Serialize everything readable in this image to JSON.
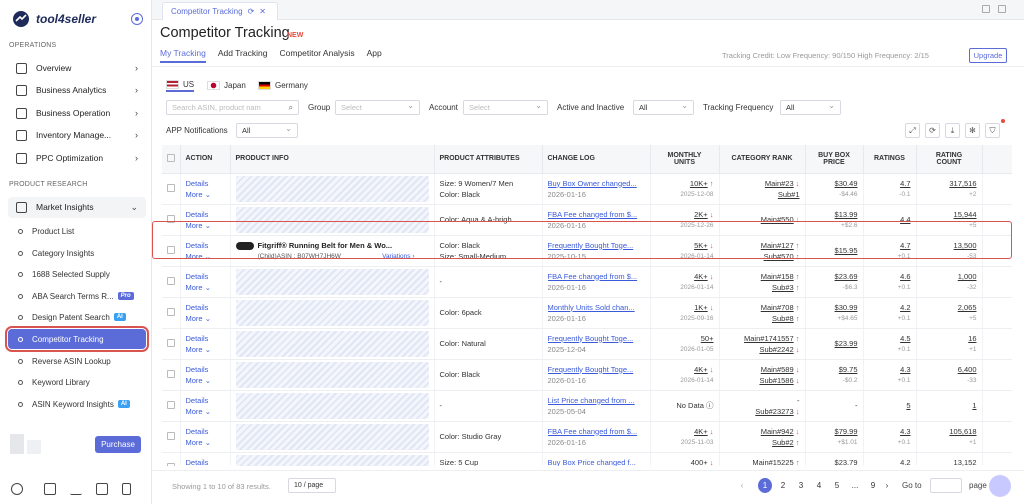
{
  "app": {
    "name": "tool4seller"
  },
  "sidebar": {
    "section_operations": "OPERATIONS",
    "operations": [
      {
        "label": "Overview",
        "icon": "home-icon"
      },
      {
        "label": "Business Analytics",
        "icon": "chart-icon"
      },
      {
        "label": "Business Operation",
        "icon": "briefcase-icon"
      },
      {
        "label": "Inventory Manage...",
        "icon": "box-icon"
      },
      {
        "label": "PPC Optimization",
        "icon": "monitor-icon"
      }
    ],
    "section_research": "PRODUCT RESEARCH",
    "market_insights": "Market Insights",
    "research_items": [
      {
        "label": "Product List",
        "badge": ""
      },
      {
        "label": "Category Insights",
        "badge": ""
      },
      {
        "label": "1688 Selected Supply",
        "badge": ""
      },
      {
        "label": "ABA Search Terms R...",
        "badge": "Pro"
      },
      {
        "label": "Design Patent Search",
        "badge": "AI"
      },
      {
        "label": "Competitor Tracking",
        "badge": ""
      },
      {
        "label": "Reverse ASIN Lookup",
        "badge": ""
      },
      {
        "label": "Keyword Library",
        "badge": ""
      },
      {
        "label": "ASIN Keyword Insights",
        "badge": "AI"
      }
    ],
    "purchase": "Purchase"
  },
  "topbar": {
    "tab_label": "Competitor Tracking"
  },
  "page": {
    "title": "Competitor Tracking",
    "title_badge": "NEW",
    "tabs": [
      "My Tracking",
      "Add Tracking",
      "Competitor Analysis",
      "App"
    ],
    "credit": "Tracking Credit: Low Frequency: 90/150 High Frequency: 2/15",
    "upgrade": "Upgrade"
  },
  "markets": [
    "US",
    "Japan",
    "Germany"
  ],
  "filters": {
    "search_placeholder": "Search ASIN, product nam",
    "group_label": "Group",
    "group_placeholder": "Select",
    "account_label": "Account",
    "account_placeholder": "Select",
    "active_label": "Active and Inactive",
    "active_value": "All",
    "frequency_label": "Tracking Frequency",
    "frequency_value": "All",
    "app_label": "APP Notifications",
    "app_value": "All"
  },
  "table": {
    "headers": {
      "action": "ACTION",
      "product_info": "PRODUCT INFO",
      "attributes": "PRODUCT ATTRIBUTES",
      "change_log": "CHANGE LOG",
      "monthly_units_1": "MONTHLY",
      "monthly_units_2": "UNITS",
      "category_rank": "CATEGORY RANK",
      "buy_box_1": "BUY BOX",
      "buy_box_2": "PRICE",
      "ratings": "RATINGS",
      "rating_count_1": "RATING",
      "rating_count_2": "COUNT"
    },
    "details": "Details",
    "more": "More",
    "rows": [
      {
        "attr1": "Size: 9 Women/7 Men",
        "attr2": "Color: Black",
        "log": "Buy Box Owner changed...",
        "log_date": "2026-01-16",
        "units": "10K+",
        "units_dir": "up",
        "units_date": "2025-12-08",
        "main": "Main#23",
        "main_dir": "down",
        "sub": "Sub#1",
        "sub_dir": "",
        "price": "$30.49",
        "price_delta": "-$4.46",
        "rating": "4.7",
        "rating_delta": "-0.1",
        "count": "317,516",
        "count_delta": "+2"
      },
      {
        "attr1": "Color: Aqua & A-brigh...",
        "attr2": "",
        "log": "FBA Fee changed from $...",
        "log_date": "2026-01-16",
        "units": "2K+",
        "units_dir": "down",
        "units_date": "2025-12-26",
        "main": "Main#550",
        "main_dir": "down",
        "sub": "",
        "sub_dir": "",
        "price": "$13.99",
        "price_delta": "+$2.6",
        "rating": "4.4",
        "rating_delta": "",
        "count": "15,944",
        "count_delta": "+5"
      },
      {
        "attr1": "Color: Black",
        "attr2": "Size: Small-Medium",
        "log": "Frequently Bought Toge...",
        "log_date": "2025-10-15",
        "units": "5K+",
        "units_dir": "down",
        "units_date": "2026-01-14",
        "main": "Main#127",
        "main_dir": "up",
        "sub": "Sub#570",
        "sub_dir": "up",
        "price": "$15.95",
        "price_delta": "",
        "rating": "4.7",
        "rating_delta": "+0.1",
        "count": "13,500",
        "count_delta": "-53",
        "product_title": "Fitgriff® Running Belt for Men & Wo...",
        "asin": "(Child)ASIN : B07WH7JH6W",
        "variations": "Variations"
      },
      {
        "attr1": "-",
        "attr2": "",
        "log": "FBA Fee changed from $...",
        "log_date": "2026-01-16",
        "units": "4K+",
        "units_dir": "down",
        "units_date": "2026-01-14",
        "main": "Main#158",
        "main_dir": "up",
        "sub": "Sub#3",
        "sub_dir": "up",
        "price": "$23.69",
        "price_delta": "-$6.3",
        "rating": "4.6",
        "rating_delta": "+0.1",
        "count": "1,000",
        "count_delta": "-32"
      },
      {
        "attr1": "Color: 6pack",
        "attr2": "",
        "log": "Monthly Units Sold chan...",
        "log_date": "2026-01-16",
        "units": "1K+",
        "units_dir": "down",
        "units_date": "2025-09-16",
        "main": "Main#708",
        "main_dir": "up",
        "sub": "Sub#8",
        "sub_dir": "up",
        "price": "$30.99",
        "price_delta": "+$4.65",
        "rating": "4.2",
        "rating_delta": "+0.1",
        "count": "2,065",
        "count_delta": "+5"
      },
      {
        "attr1": "Color: Natural",
        "attr2": "",
        "log": "Frequently Bought Toge...",
        "log_date": "2025-12-04",
        "units": "50+",
        "units_dir": "",
        "units_date": "2026-01-05",
        "main": "Main#1741557",
        "main_dir": "up",
        "sub": "Sub#2242",
        "sub_dir": "down",
        "price": "$23.99",
        "price_delta": "",
        "rating": "4.5",
        "rating_delta": "+0.1",
        "count": "16",
        "count_delta": "+1"
      },
      {
        "attr1": "Color: Black",
        "attr2": "",
        "log": "Frequently Bought Toge...",
        "log_date": "2026-01-16",
        "units": "4K+",
        "units_dir": "down",
        "units_date": "2026-01-14",
        "main": "Main#589",
        "main_dir": "down",
        "sub": "Sub#1586",
        "sub_dir": "down",
        "price": "$9.75",
        "price_delta": "-$0.2",
        "rating": "4.3",
        "rating_delta": "+0.1",
        "count": "6,400",
        "count_delta": "-33"
      },
      {
        "attr1": "-",
        "attr2": "",
        "log": "List Price changed from ...",
        "log_date": "2025-05-04",
        "units": "No Data",
        "units_dir": "",
        "units_date": "",
        "main": "-",
        "main_dir": "",
        "sub": "Sub#23273",
        "sub_dir": "down",
        "price": "-",
        "price_delta": "",
        "rating": "5",
        "rating_delta": "",
        "count": "1",
        "count_delta": ""
      },
      {
        "attr1": "Color: Studio Gray",
        "attr2": "",
        "log": "FBA Fee changed from $...",
        "log_date": "2026-01-16",
        "units": "4K+",
        "units_dir": "down",
        "units_date": "2025-11-03",
        "main": "Main#942",
        "main_dir": "down",
        "sub": "Sub#2",
        "sub_dir": "up",
        "price": "$79.99",
        "price_delta": "+$1.01",
        "rating": "4.3",
        "rating_delta": "+0.1",
        "count": "105,618",
        "count_delta": "+1"
      },
      {
        "attr1": "Size: 5 Cup",
        "attr2": "Color: Teal",
        "log": "Buy Box Price changed f...",
        "log_date": "2026-01-16",
        "units": "400+",
        "units_dir": "down",
        "units_date": "2026-01-14",
        "main": "Main#15225",
        "main_dir": "up",
        "sub": "Sub#75",
        "sub_dir": "down",
        "price": "$23.79",
        "price_delta": "+$3.59",
        "rating": "4.2",
        "rating_delta": "+0.1",
        "count": "13,152",
        "count_delta": "+7"
      }
    ]
  },
  "pagination": {
    "showing": "Showing 1 to 10 of 83 results.",
    "page_size": "10 / page",
    "pages": [
      "1",
      "2",
      "3",
      "4",
      "5",
      "...",
      "9"
    ],
    "goto": "Go to",
    "page": "page"
  },
  "colors": {
    "accent": "#5b6cd9",
    "up": "#2eaa52",
    "down": "#e74c3c",
    "highlight": "#d9534f"
  }
}
